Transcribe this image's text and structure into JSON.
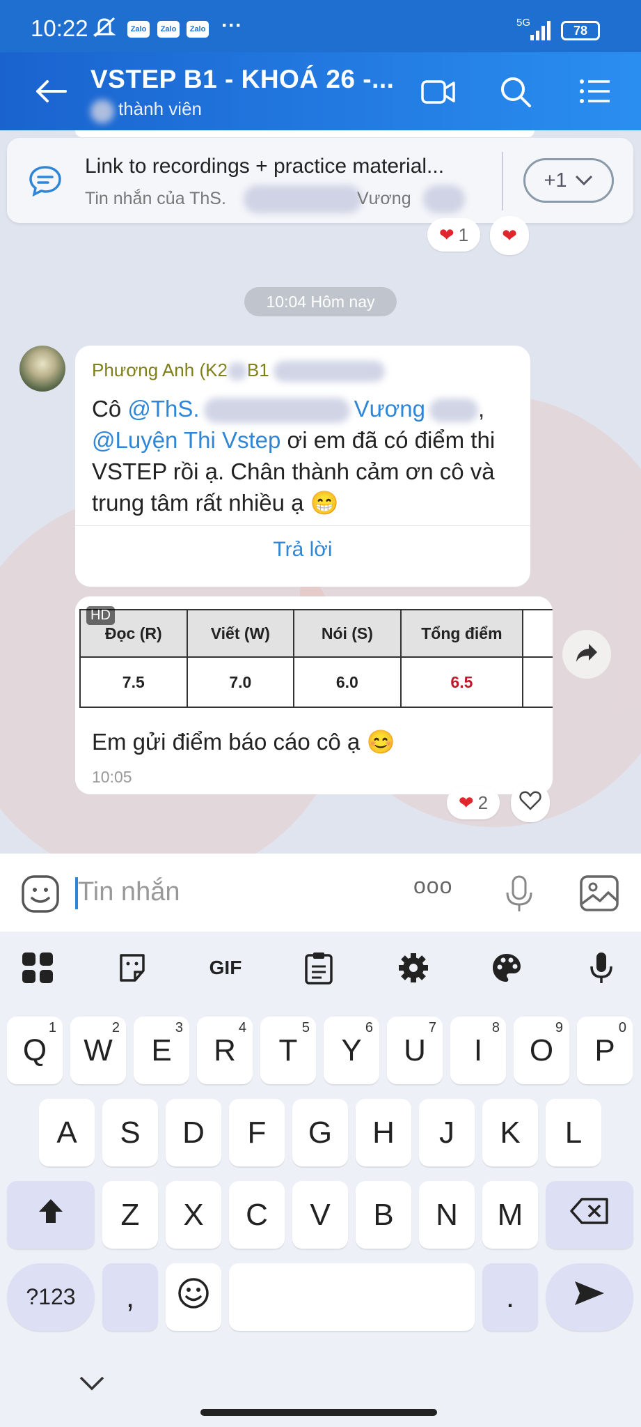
{
  "status": {
    "time": "10:22",
    "apps": [
      "Zalo",
      "Zalo",
      "Zalo"
    ],
    "more": "···",
    "network": "5G",
    "battery": "78"
  },
  "header": {
    "title": "VSTEP B1 - KHOÁ 26 -...",
    "subtitle": "thành viên"
  },
  "pinned": {
    "title": "Link to recordings + practice material...",
    "sub_prefix": "Tin nhắn của ThS.",
    "sub_name": "Vương",
    "more_count": "+1"
  },
  "above_reactions": {
    "count": "1"
  },
  "date_divider": "10:04 Hôm nay",
  "message1": {
    "sender_prefix": "Phương Anh (K2",
    "sender_suffix": "B1",
    "lead": "Cô ",
    "mention1": "@ThS.",
    "mention1_name": "Vương",
    "comma": ",",
    "mention2": "@Luyện Thi Vstep",
    "body": " ơi em đã có điểm thi VSTEP rồi ạ. Chân thành cảm ơn cô và trung tâm rất nhiều ạ 😁",
    "reply_label": "Trả lời"
  },
  "message2": {
    "hd_badge": "HD",
    "table_headers": [
      "Đọc (R)",
      "Viết (W)",
      "Nói (S)",
      "Tổng điểm"
    ],
    "table_values": [
      "7.5",
      "7.0",
      "6.0",
      "6.5"
    ],
    "text": "Em gửi điểm báo cáo cô ạ 😊",
    "time": "10:05",
    "reaction_count": "2"
  },
  "input": {
    "placeholder": "Tin nhắn",
    "more": "ooo"
  },
  "keyboard": {
    "toolbar": [
      "apps-icon",
      "sticker-icon",
      "GIF",
      "clipboard-icon",
      "settings-icon",
      "palette-icon",
      "mic-icon"
    ],
    "gif_label": "GIF",
    "row1": [
      {
        "k": "Q",
        "n": "1"
      },
      {
        "k": "W",
        "n": "2"
      },
      {
        "k": "E",
        "n": "3"
      },
      {
        "k": "R",
        "n": "4"
      },
      {
        "k": "T",
        "n": "5"
      },
      {
        "k": "Y",
        "n": "6"
      },
      {
        "k": "U",
        "n": "7"
      },
      {
        "k": "I",
        "n": "8"
      },
      {
        "k": "O",
        "n": "9"
      },
      {
        "k": "P",
        "n": "0"
      }
    ],
    "row2": [
      "A",
      "S",
      "D",
      "F",
      "G",
      "H",
      "J",
      "K",
      "L"
    ],
    "row3": [
      "Z",
      "X",
      "C",
      "V",
      "B",
      "N",
      "M"
    ],
    "symbols": "?123",
    "comma": ",",
    "period": "."
  },
  "colors": {
    "header": "#2a8ef0",
    "mention": "#2f86d6",
    "sender": "#7f7f1a",
    "heart": "#e0262c",
    "total_score": "#c0182c"
  }
}
